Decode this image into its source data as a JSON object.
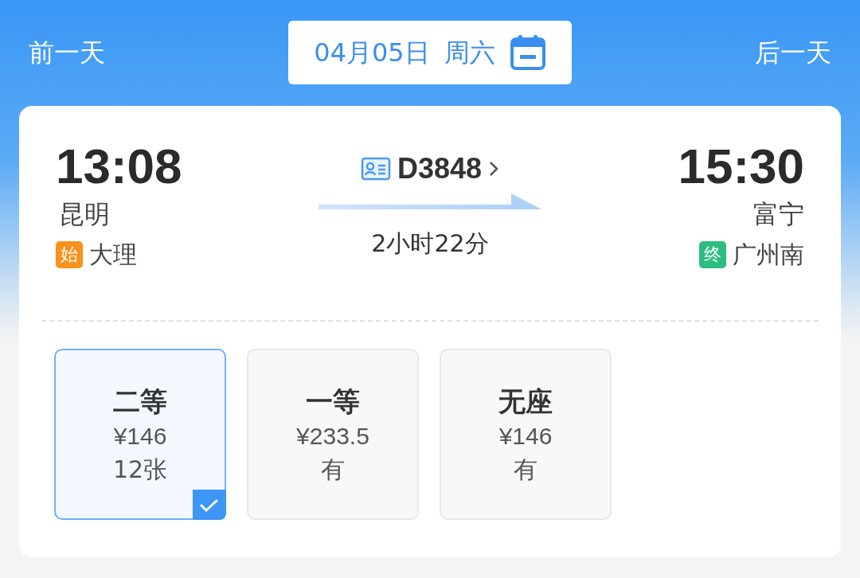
{
  "date_nav": {
    "prev": "前一天",
    "date": "04月05日",
    "weekday": "周六",
    "next": "后一天"
  },
  "train": {
    "depart_time": "13:08",
    "depart_station": "昆明",
    "number": "D3848",
    "duration": "2小时22分",
    "arrive_time": "15:30",
    "arrive_station": "富宁"
  },
  "endpoints": [
    {
      "kind": "origin",
      "badge": "始",
      "color": "#f7921e",
      "station": "大理"
    },
    {
      "kind": "terminus",
      "badge": "终",
      "color": "#2dbd7e",
      "station": "广州南"
    }
  ],
  "seats": [
    {
      "name": "二等",
      "price": "¥146",
      "availability": "12张",
      "selected": true
    },
    {
      "name": "一等",
      "price": "¥233.5",
      "availability": "有",
      "selected": false
    },
    {
      "name": "无座",
      "price": "¥146",
      "availability": "有",
      "selected": false
    }
  ]
}
